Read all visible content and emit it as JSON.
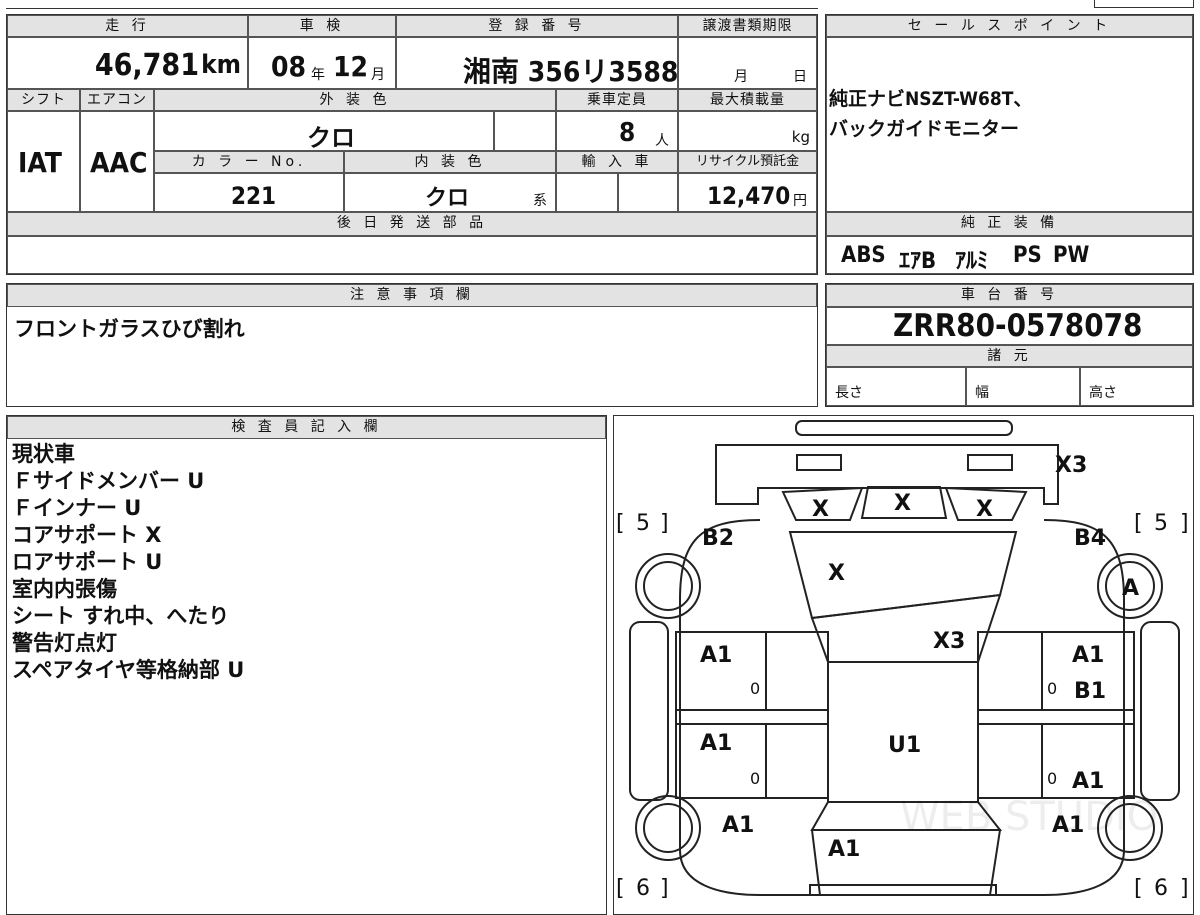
{
  "top_row": {
    "mileage_label": "走 行",
    "mileage_value": "46,781",
    "mileage_unit": "km",
    "inspection_label": "車 検",
    "inspection_year": "08",
    "year_suffix": "年",
    "inspection_month": "12",
    "month_suffix": "月",
    "registration_label": "登 録 番 号",
    "registration_value": "湘南 356リ3588",
    "transfer_label": "譲渡書類期限",
    "transfer_month": "月",
    "transfer_day": "日"
  },
  "mid_rows": {
    "shift_label": "シフト",
    "shift_value": "IAT",
    "aircon_label": "エアコン",
    "aircon_value": "AAC",
    "exterior_color_label": "外 装 色",
    "exterior_color_value": "クロ",
    "capacity_label": "乗車定員",
    "capacity_value": "8",
    "capacity_unit": "人",
    "max_load_label": "最大積載量",
    "max_load_unit": "kg",
    "color_no_label": "カ ラ ー No.",
    "color_no_value": "221",
    "interior_color_label": "内 装 色",
    "interior_color_value": "クロ",
    "interior_suffix": "系",
    "import_label": "輸 入 車",
    "recycle_label": "リサイクル預託金",
    "recycle_value": "12,470",
    "recycle_unit": "円"
  },
  "later_parts": {
    "label": "後 日 発 送 部 品",
    "value": ""
  },
  "sales_point": {
    "label": "セ ー ル ス ポ イ ン ト",
    "line1": "純正ナビNSZT-W68T、",
    "line2": "バックガイドモニター"
  },
  "genuine_equipment": {
    "label": "純 正 装 備",
    "items": [
      "ABS",
      "ｴｱB",
      "ｱﾙﾐ",
      "PS",
      "PW"
    ]
  },
  "notes": {
    "label": "注 意 事 項 欄",
    "value": "フロントガラスひび割れ"
  },
  "chassis": {
    "label": "車 台 番 号",
    "value": "ZRR80-0578078"
  },
  "specs": {
    "label": "諸 元",
    "length": "長さ",
    "width": "幅",
    "height": "高さ"
  },
  "inspector": {
    "label": "検 査 員 記 入 欄",
    "lines": [
      "現状車",
      "Ｆサイドメンバー U",
      "Ｆインナー U",
      "コアサポート X",
      "ロアサポート U",
      "室内内張傷",
      "シート すれ中、へたり",
      "警告灯点灯",
      "スペアタイヤ等格納部 U"
    ]
  },
  "diagram_marks": {
    "roof_top_right": "X3",
    "glass_left": "X",
    "glass_center": "X",
    "glass_right": "X",
    "bracket_tl": "5",
    "bracket_tr": "5",
    "bracket_bl": "6",
    "bracket_br": "6",
    "fender_fl": "B2",
    "fender_fr": "B4",
    "windshield": "X",
    "wheel_fr": "A",
    "hood_right": "X3",
    "door_fl": "A1",
    "door_fr": "A1",
    "door_fr_b": "B1",
    "door_rl": "A1",
    "door_rr": "A1",
    "roof": "U1",
    "rear_l": "A1",
    "rear_r": "A1",
    "trunk": "A1",
    "zero_1": "0",
    "zero_2": "0",
    "zero_3": "0",
    "zero_4": "0",
    "watermark": "WEB STUDIO"
  }
}
